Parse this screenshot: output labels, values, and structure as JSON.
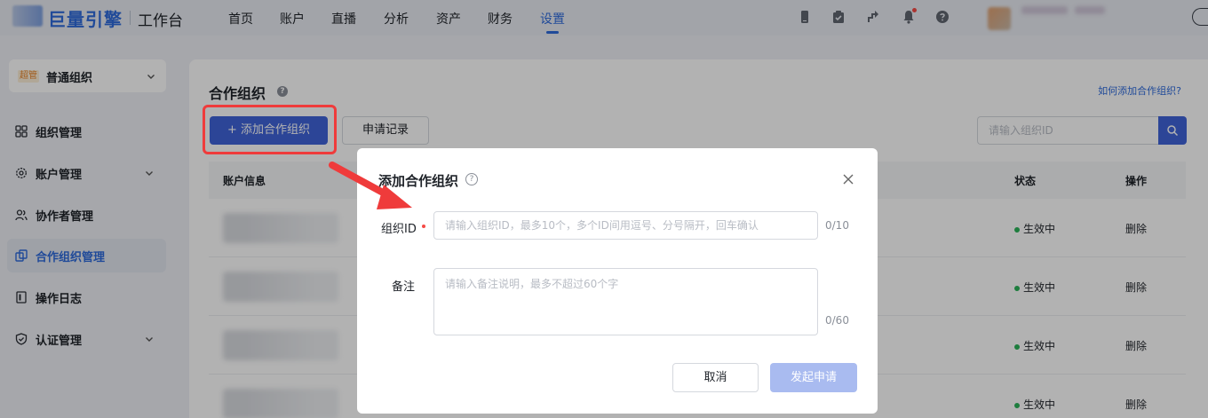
{
  "app": {
    "logo_text": "巨量引擎",
    "workspace": "工作台"
  },
  "nav": {
    "items": [
      {
        "label": "首页"
      },
      {
        "label": "账户"
      },
      {
        "label": "直播"
      },
      {
        "label": "分析"
      },
      {
        "label": "资产"
      },
      {
        "label": "财务"
      },
      {
        "label": "设置",
        "active": true
      }
    ]
  },
  "top_icons": [
    "mobile-icon",
    "clipboard-check-icon",
    "shortcut-icon",
    "bell-icon",
    "help-icon"
  ],
  "sidebar": {
    "org_tag": "超管",
    "org_name": "普通组织",
    "items": [
      {
        "label": "组织管理",
        "icon": "grid-icon"
      },
      {
        "label": "账户管理",
        "icon": "gear-icon",
        "expandable": true
      },
      {
        "label": "协作者管理",
        "icon": "users-icon"
      },
      {
        "label": "合作组织管理",
        "icon": "link-copy-icon",
        "active": true
      },
      {
        "label": "操作日志",
        "icon": "log-icon"
      },
      {
        "label": "认证管理",
        "icon": "shield-check-icon",
        "expandable": true
      }
    ]
  },
  "main": {
    "title": "合作组织",
    "help_link": "如何添加合作组织?",
    "add_button": "+ 添加合作组织",
    "records_button": "申请记录",
    "search_placeholder": "请输入组织ID",
    "table": {
      "columns": [
        "账户信息",
        "状态",
        "操作"
      ],
      "rows": [
        {
          "status": "生效中",
          "action": "删除"
        },
        {
          "status": "生效中",
          "action": "删除"
        },
        {
          "status": "生效中",
          "action": "删除"
        },
        {
          "status": "生效中",
          "action": "删除"
        }
      ]
    }
  },
  "modal": {
    "title": "添加合作组织",
    "org_id_label": "组织ID",
    "org_id_placeholder": "请输入组织ID，最多10个，多个ID间用逗号、分号隔开，回车确认",
    "org_id_counter": "0/10",
    "note_label": "备注",
    "note_placeholder": "请输入备注说明，最多不超过60个字",
    "note_counter": "0/60",
    "cancel": "取消",
    "submit": "发起申请"
  },
  "colors": {
    "brand": "#2f6bdb",
    "primary_button": "#3f63d8",
    "disabled_button": "#a9bbf0",
    "highlight": "#ef3b3b",
    "active_status": "#2bb35a"
  }
}
